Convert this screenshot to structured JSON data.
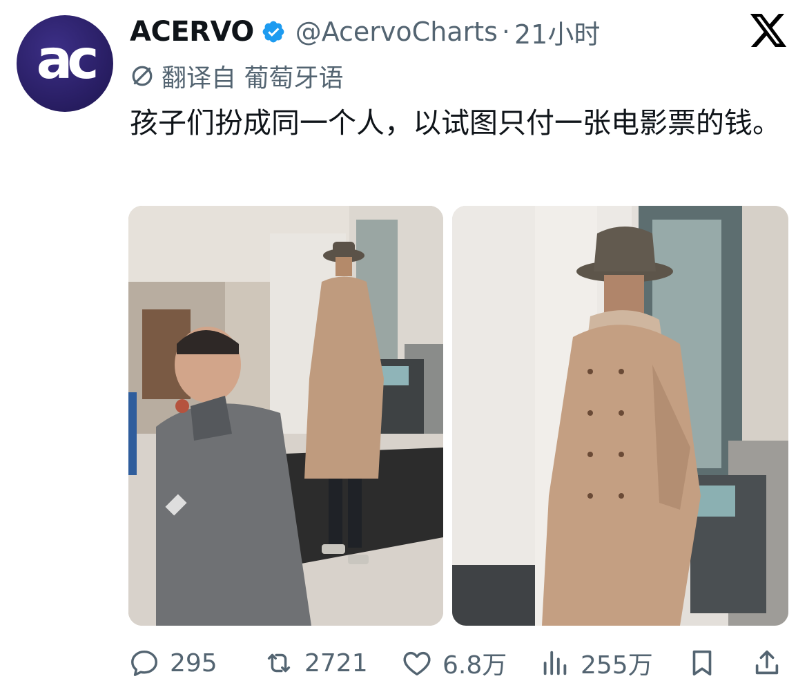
{
  "account": {
    "avatar_text": "ac",
    "display_name": "ACERVO",
    "handle": "@AcervoCharts",
    "separator": "·",
    "time": "21小时"
  },
  "translation": {
    "label": "翻译自 葡萄牙语"
  },
  "tweet": {
    "text": "孩子们扮成同一个人，以试图只付一张电影票的钱。"
  },
  "actions": {
    "replies": "295",
    "retweets": "2721",
    "likes": "6.8万",
    "views": "255万"
  },
  "colors": {
    "verified_badge": "#1d9bf0",
    "muted_text": "#536471",
    "primary_text": "#0f1419",
    "avatar_bg": "#2a1f66"
  },
  "icons": [
    "verified-badge-icon",
    "x-logo-icon",
    "translate-icon",
    "reply-icon",
    "retweet-icon",
    "like-icon",
    "views-icon",
    "bookmark-icon",
    "share-icon"
  ]
}
